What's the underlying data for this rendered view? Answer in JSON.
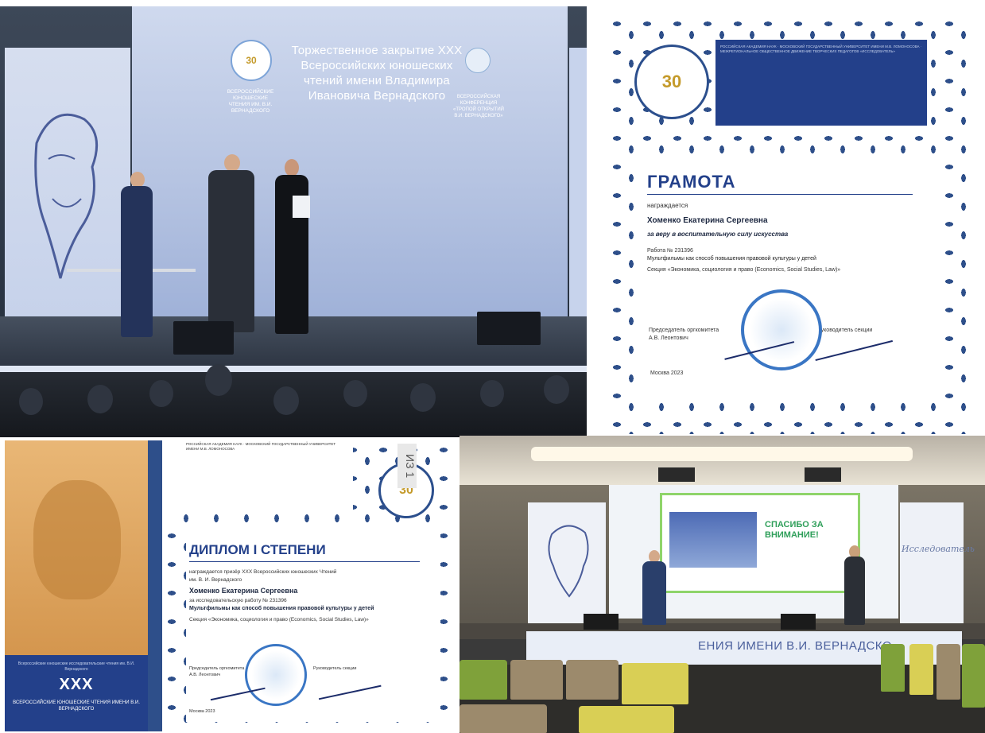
{
  "panel_stage": {
    "slide_title": "Торжественное закрытие XXX Всероссийских юношеских чтений имени Владимира Ивановича Вернадского",
    "logo_left_caption": "ВСЕРОССИЙСКИЕ ЮНОШЕСКИЕ ЧТЕНИЯ ИМ. В.И. ВЕРНАДСКОГО",
    "logo_right_caption": "ВСЕРОССИЙСКАЯ КОНФЕРЕНЦИЯ «ТРОПОЙ ОТКРЫТИЙ В.И. ВЕРНАДСКОГО»",
    "logo_badge": "30"
  },
  "panel_gramota": {
    "seal_badge": "30",
    "header_lines": "РОССИЙСКАЯ АКАДЕМИЯ НАУК · МОСКОВСКИЙ ГОСУДАРСТВЕННЫЙ УНИВЕРСИТЕТ ИМЕНИ М.В. ЛОМОНОСОВА · МЕЖРЕГИОНАЛЬНОЕ ОБЩЕСТВЕННОЕ ДВИЖЕНИЕ ТВОРЧЕСКИХ ПЕДАГОГОВ «ИССЛЕДОВАТЕЛЬ»",
    "title": "ГРАМОТА",
    "awarded": "награждается",
    "name": "Хоменко Екатерина Сергеевна",
    "reason": "за веру в воспитательную силу искусства",
    "work": "Работа № 231396",
    "topic": "Мультфильмы как способ повышения правовой культуры у детей",
    "section": "Секция «Экономика, социология и право (Economics, Social Studies, Law)»",
    "chair_label": "Председатель оргкомитета",
    "chair_name": "А.В. Леонтович",
    "head_label": "Руководитель секции",
    "city_year": "Москва 2023"
  },
  "panel_diploma": {
    "side_caption": "Всероссийские юношеские исследовательские чтения им. В.И. Вернадского",
    "side_numeral": "XXX",
    "side_subtitle": "ВСЕРОССИЙСКИЕ ЮНОШЕСКИЕ ЧТЕНИЯ ИМЕНИ В.И. ВЕРНАДСКОГО",
    "header_lines": "РОССИЙСКАЯ АКАДЕМИЯ НАУК · МОСКОВСКИЙ ГОСУДАРСТВЕННЫЙ УНИВЕРСИТЕТ ИМЕНИ М.В. ЛОМОНОСОВА",
    "seal_badge": "30",
    "tag": "ИЗ 1",
    "title": "ДИПЛОМ I СТЕПЕНИ",
    "line1": "награждается призёр XXX Всероссийских юношеских Чтений",
    "line2": "им. В. И. Вернадского",
    "name": "Хоменко Екатерина Сергеевна",
    "line3": "за исследовательскую работу № 231396",
    "topic": "Мультфильмы как способ повышения правовой культуры у детей",
    "section": "Секция «Экономика, социология и право (Economics, Social Studies, Law)»",
    "chair_label": "Председатель оргкомитета",
    "chair_name": "А.В. Леонтович",
    "head_label": "Руководитель секции",
    "city_year": "Москва 2023"
  },
  "panel_hall": {
    "slide_text": "СПАСИБО ЗА ВНИМАНИЕ!",
    "banner_right": "Исследователь",
    "stage_front": "ЕНИЯ ИМЕНИ В.И. ВЕРНАДСКО"
  }
}
